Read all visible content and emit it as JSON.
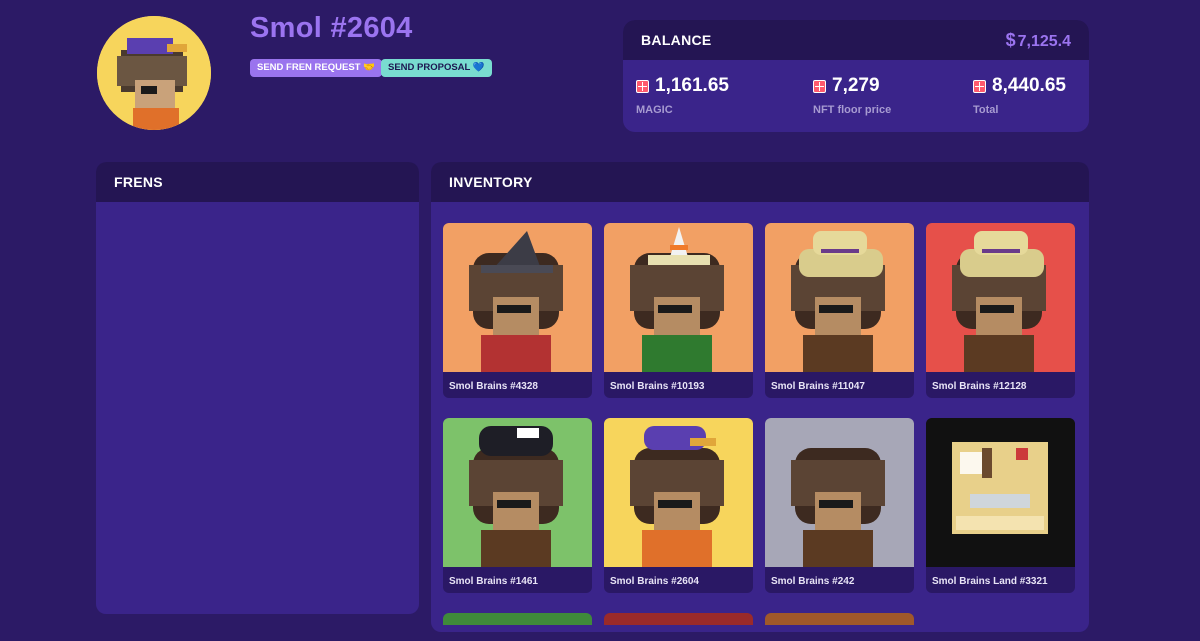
{
  "profile": {
    "name": "Smol #2604",
    "send_fren_request": "SEND FREN REQUEST 🤝",
    "send_proposal": "SEND PROPOSAL 💙"
  },
  "balance": {
    "title": "BALANCE",
    "usd_symbol": "$",
    "usd_value": "7,125.4",
    "stats": [
      {
        "value": "1,161.65",
        "label": "MAGIC"
      },
      {
        "value": "7,279",
        "label": "NFT floor price"
      },
      {
        "value": "8,440.65",
        "label": "Total"
      }
    ]
  },
  "frens": {
    "title": "FRENS"
  },
  "inventory": {
    "title": "INVENTORY",
    "items": [
      {
        "label": "Smol Brains #4328",
        "bg": "#f2a064",
        "hat": "wizard",
        "accent": "#b33232"
      },
      {
        "label": "Smol Brains #10193",
        "bg": "#f2a064",
        "hat": "cone",
        "accent": "#2f7a2f"
      },
      {
        "label": "Smol Brains #11047",
        "bg": "#f2a064",
        "hat": "straw",
        "accent": "#5b3a22"
      },
      {
        "label": "Smol Brains #12128",
        "bg": "#e6504a",
        "hat": "straw",
        "accent": "#5b3a22"
      },
      {
        "label": "Smol Brains #1461",
        "bg": "#7dc26a",
        "hat": "beanie",
        "accent": "#5b3a22"
      },
      {
        "label": "Smol Brains #2604",
        "bg": "#f7d55c",
        "hat": "cap",
        "accent": "#e0702a"
      },
      {
        "label": "Smol Brains #242",
        "bg": "#a7a7b7",
        "hat": "none",
        "accent": "#5b3a22"
      },
      {
        "label": "Smol Brains Land #3321",
        "bg": "#111111",
        "hat": "land",
        "accent": "#e8d08a"
      }
    ],
    "next_row_colors": [
      "#3f8a3a",
      "#9a2a2a",
      "#a0582a"
    ]
  }
}
